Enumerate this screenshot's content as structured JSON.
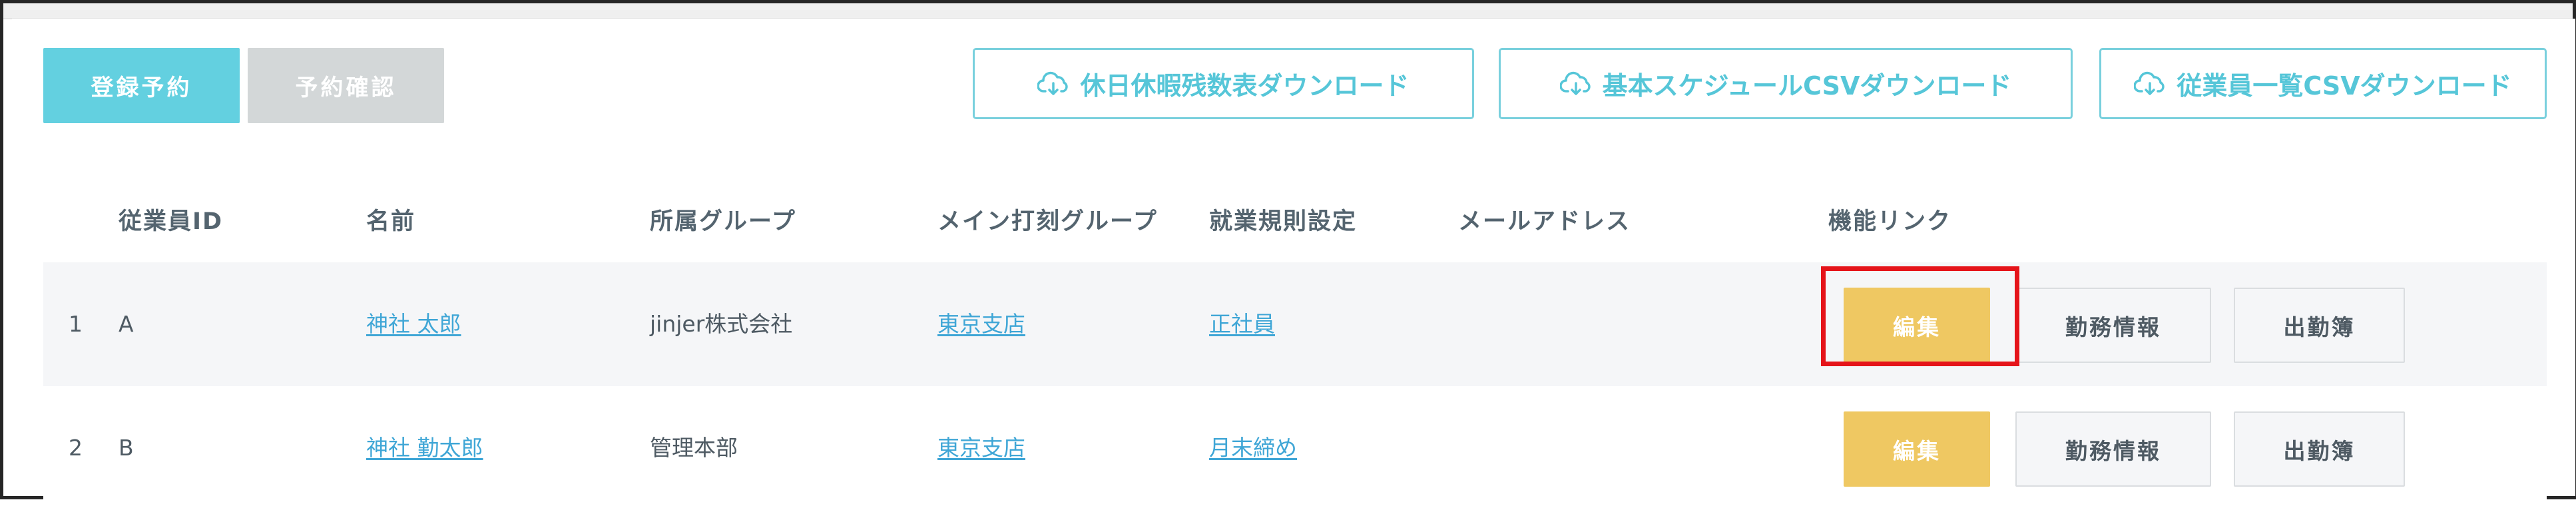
{
  "toolbar": {
    "register_label": "登録予約",
    "confirm_label": "予約確認",
    "download_holiday_label": "休日休暇残数表ダウンロード",
    "download_schedule_label": "基本スケジュールCSVダウンロード",
    "download_employee_label": "従業員一覧CSVダウンロード",
    "download_icon": "cloud-download-icon"
  },
  "table": {
    "headers": {
      "employee_id": "従業員ID",
      "name": "名前",
      "group": "所属グループ",
      "clock_group": "メイン打刻グループ",
      "work_rule": "就業規則設定",
      "email": "メールアドレス",
      "links": "機能リンク"
    },
    "rows": [
      {
        "index": "1",
        "employee_id": "A",
        "name": "神社 太郎",
        "group": "jinjer株式会社",
        "clock_group": "東京支店",
        "work_rule": "正社員",
        "email": "",
        "edit_label": "編集",
        "work_info_label": "勤務情報",
        "attendance_label": "出勤簿"
      },
      {
        "index": "2",
        "employee_id": "B",
        "name": "神社 勤太郎",
        "group": "管理本部",
        "clock_group": "東京支店",
        "work_rule": "月末締め",
        "email": "",
        "edit_label": "編集",
        "work_info_label": "勤務情報",
        "attendance_label": "出勤簿"
      }
    ]
  },
  "colors": {
    "primary": "#63d0e0",
    "disabled": "#d3d7d8",
    "edit": "#efc862",
    "link": "#3fa6d6",
    "highlight": "#e5141a"
  }
}
